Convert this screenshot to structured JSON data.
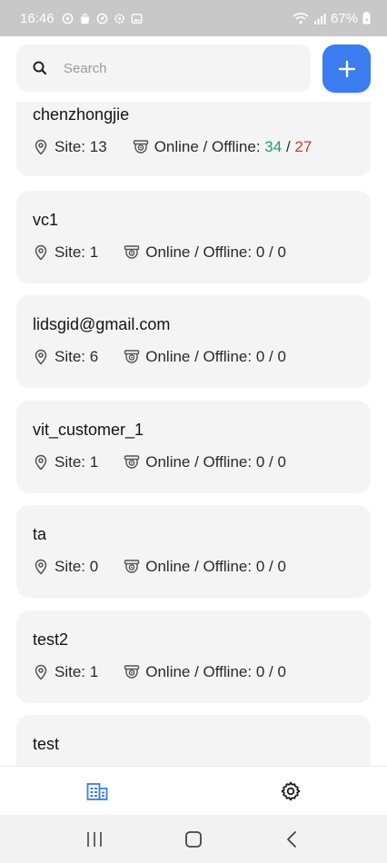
{
  "status_bar": {
    "time": "16:46",
    "battery": "67%"
  },
  "search": {
    "placeholder": "Search"
  },
  "colors": {
    "accent": "#3b7cf0",
    "online": "#1f9a7a",
    "offline": "#d03a2a"
  },
  "customers": [
    {
      "name": "chenzhongjie",
      "site_label": "Site:",
      "site_count": "13",
      "status_label": "Online / Offline:",
      "online": "34",
      "separator": "/",
      "offline": "27"
    },
    {
      "name": "vc1",
      "site_label": "Site:",
      "site_count": "1",
      "status_label": "Online / Offline:",
      "online": "0",
      "separator": "/",
      "offline": "0"
    },
    {
      "name": "lidsgid@gmail.com",
      "site_label": "Site:",
      "site_count": "6",
      "status_label": "Online / Offline:",
      "online": "0",
      "separator": "/",
      "offline": "0"
    },
    {
      "name": "vit_customer_1",
      "site_label": "Site:",
      "site_count": "1",
      "status_label": "Online / Offline:",
      "online": "0",
      "separator": "/",
      "offline": "0"
    },
    {
      "name": "ta",
      "site_label": "Site:",
      "site_count": "0",
      "status_label": "Online / Offline:",
      "online": "0",
      "separator": "/",
      "offline": "0"
    },
    {
      "name": "test2",
      "site_label": "Site:",
      "site_count": "1",
      "status_label": "Online / Offline:",
      "online": "0",
      "separator": "/",
      "offline": "0"
    },
    {
      "name": "test"
    }
  ],
  "tabs": [
    {
      "icon": "building-icon",
      "active": true
    },
    {
      "icon": "gear-icon",
      "active": false
    }
  ]
}
